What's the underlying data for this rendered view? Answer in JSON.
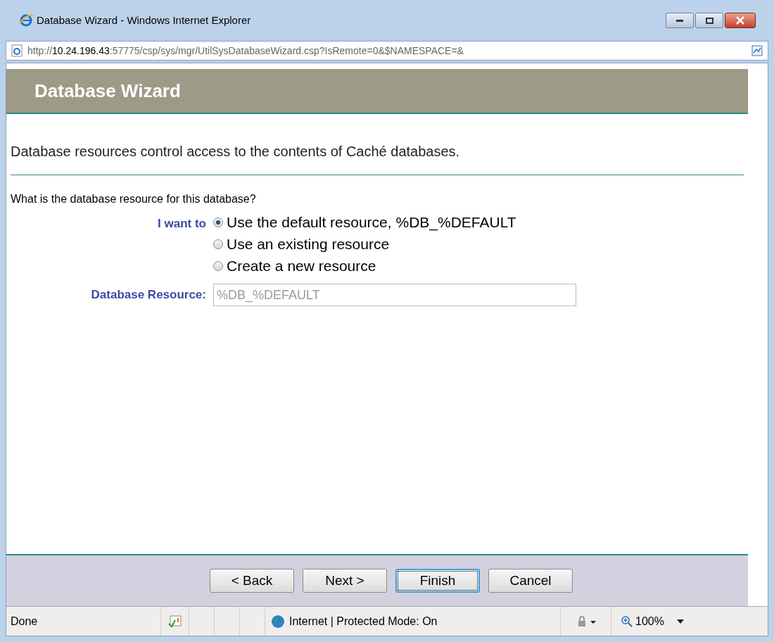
{
  "window": {
    "title": "Database Wizard - Windows Internet Explorer"
  },
  "address_bar": {
    "url": "http://**10.24.196.43**:57775/csp/sys/mgr/UtilSysDatabaseWizard.csp?IsRemote=0&$NAMESPACE=&"
  },
  "page": {
    "header": "Database Wizard",
    "intro": "Database resources control access to the contents of Caché databases.",
    "question": "What is the database resource for this database?",
    "choice": {
      "label": "I want to",
      "options": [
        {
          "label": "Use the default resource, %DB_%DEFAULT",
          "selected": true
        },
        {
          "label": "Use an existing resource",
          "selected": false
        },
        {
          "label": "Create a new resource",
          "selected": false
        }
      ]
    },
    "resource_field": {
      "label": "Database Resource:",
      "value": "%DB_%DEFAULT",
      "disabled": true
    },
    "buttons": [
      {
        "label": "< Back",
        "focused": false
      },
      {
        "label": "Next >",
        "focused": false
      },
      {
        "label": "Finish",
        "focused": true
      },
      {
        "label": "Cancel",
        "focused": false
      }
    ]
  },
  "status_bar": {
    "status": "Done",
    "zone": "Internet | Protected Mode: On",
    "zoom": "100%"
  }
}
